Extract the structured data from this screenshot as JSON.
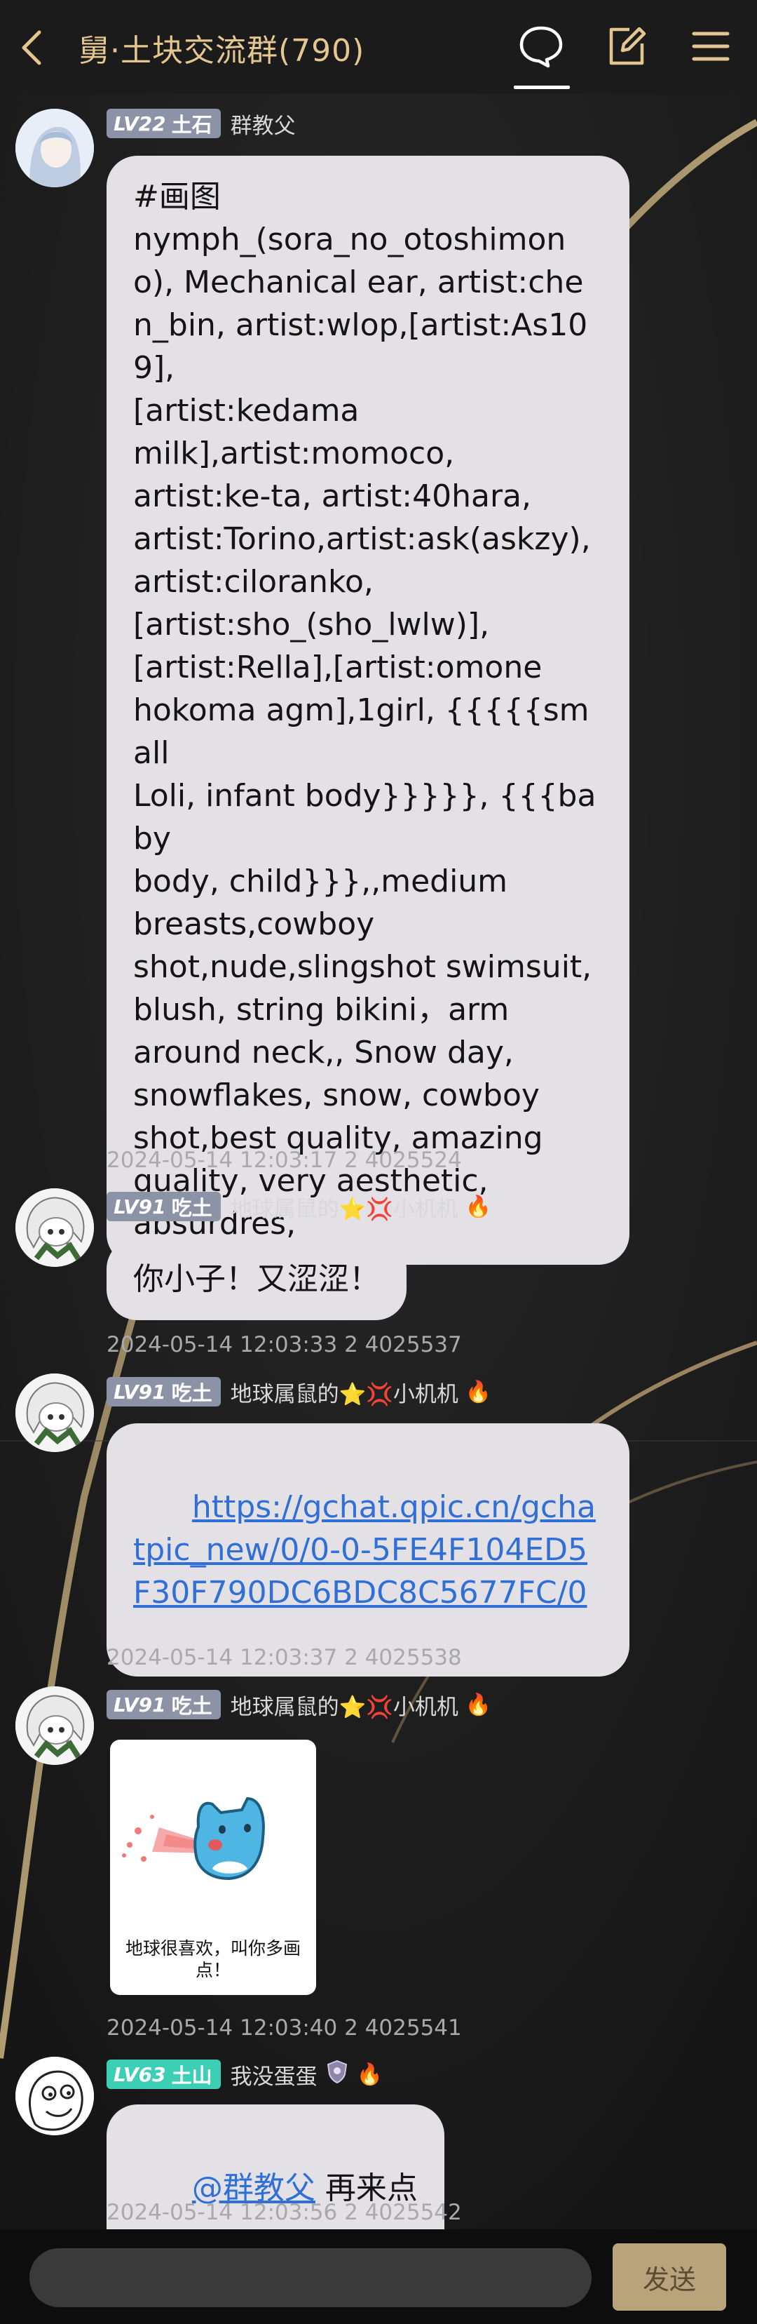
{
  "header": {
    "back_icon": "chevron-left-icon",
    "title": "舅·土块交流群(790)",
    "actions": [
      {
        "icon": "chat-bubble-icon",
        "active": true
      },
      {
        "icon": "edit-square-icon"
      },
      {
        "icon": "hamburger-menu-icon"
      }
    ],
    "accent_color": "#e3c690"
  },
  "messages": [
    {
      "level": "LV22",
      "rank": "土石",
      "nickname": "群教父",
      "text": "#画图\nnymph_(sora_no_otoshimono), Mechanical ear, artist:chen_bin, artist:wlop,[artist:As109],\n[artist:kedama\nmilk],artist:momoco,\nartist:ke-ta, artist:40hara,\nartist:Torino,artist:ask(askzy),artist:ciloranko,\n[artist:sho_(sho_lwlw)],\n[artist:Rella],[artist:omone\nhokoma agm],1girl, {{{{{small\nLoli, infant body}}}}}, {{{baby\nbody, child}}},,medium\nbreasts,cowboy\nshot,nude,slingshot swimsuit,\nblush, string bikini，arm\naround neck,, Snow day,\nsnowflakes, snow, cowboy\nshot,best quality, amazing\nquality, very aesthetic,\nabsurdres,",
      "time": "2024-05-14 12:03:17 2 4025524"
    },
    {
      "level": "LV91",
      "rank": "吃土",
      "nickname": "地球属鼠的⭐💢小机机",
      "nick_emoji": "🔥",
      "text": "你小子！又涩涩！",
      "time": "2024-05-14 12:03:33 2 4025537"
    },
    {
      "level": "LV91",
      "rank": "吃土",
      "nickname": "地球属鼠的⭐💢小机机",
      "nick_emoji": "🔥",
      "link": "https://gchat.qpic.cn/gchatpic_new/0/0-0-5FE4F104ED5F30F790DC6BDC8C5677FC/0",
      "time": "2024-05-14 12:03:37 2 4025538"
    },
    {
      "level": "LV91",
      "rank": "吃土",
      "nickname": "地球属鼠的⭐💢小机机",
      "nick_emoji": "🔥",
      "sticker_caption": "地球很喜欢，叫你多画点！",
      "time": "2024-05-14 12:03:40 2 4025541"
    },
    {
      "level": "LV63",
      "rank": "土山",
      "nickname": "我没蛋蛋",
      "nick_emoji": "🔥",
      "mention": "@群教父",
      "text": " 再来点",
      "time": "2024-05-14 12:03:56 2 4025542"
    }
  ],
  "input": {
    "placeholder": "",
    "send_label": "发送"
  }
}
